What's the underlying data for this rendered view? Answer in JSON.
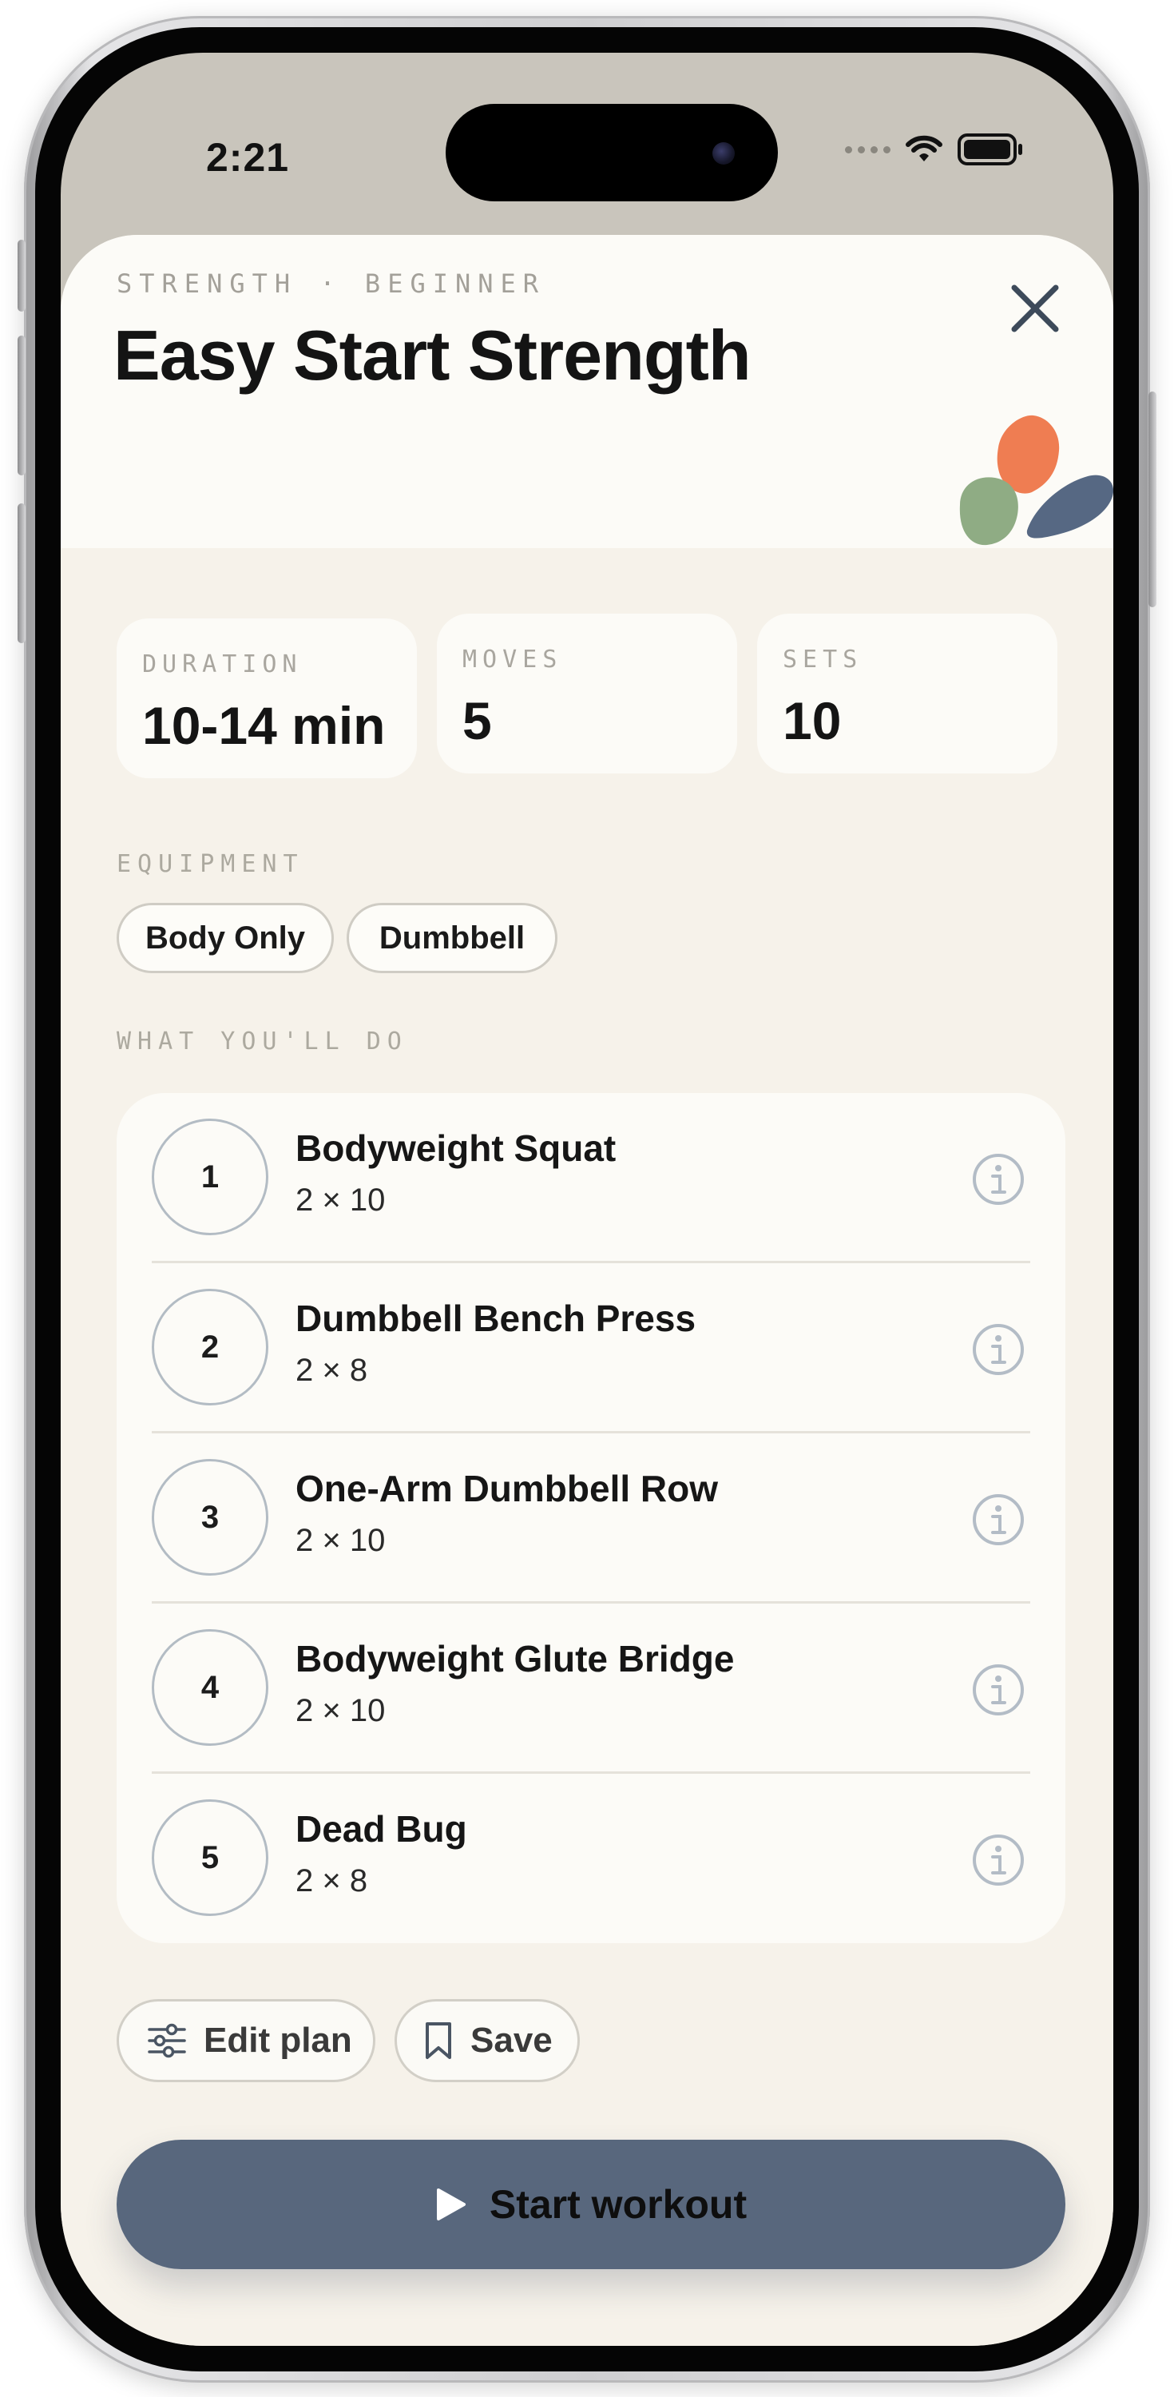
{
  "status_bar": {
    "time": "2:21"
  },
  "header": {
    "kicker": "STRENGTH · BEGINNER",
    "title": "Easy Start Strength"
  },
  "stats": [
    {
      "label": "DURATION",
      "value": "10-14 min"
    },
    {
      "label": "MOVES",
      "value": "5"
    },
    {
      "label": "SETS",
      "value": "10"
    }
  ],
  "equipment": {
    "label": "EQUIPMENT",
    "items": [
      "Body Only",
      "Dumbbell"
    ]
  },
  "plan": {
    "label": "WHAT YOU'LL DO",
    "exercises": [
      {
        "number": "1",
        "name": "Bodyweight Squat",
        "scheme": "2 × 10"
      },
      {
        "number": "2",
        "name": "Dumbbell Bench Press",
        "scheme": "2 × 8"
      },
      {
        "number": "3",
        "name": "One-Arm Dumbbell Row",
        "scheme": "2 × 10"
      },
      {
        "number": "4",
        "name": "Bodyweight Glute Bridge",
        "scheme": "2 × 10"
      },
      {
        "number": "5",
        "name": "Dead Bug",
        "scheme": "2 × 8"
      }
    ]
  },
  "actions": {
    "edit_label": "Edit plan",
    "save_label": "Save",
    "start_label": "Start workout"
  },
  "colors": {
    "accent": "#58677d",
    "sheet_background": "#f6f2ea",
    "card_background": "#fcfbf7",
    "blob_orange": "#ef7d52",
    "blob_green": "#8fac84",
    "blob_slate": "#566883"
  },
  "icons": {
    "close": "close-icon",
    "info": "info-icon",
    "edit": "sliders-icon",
    "save": "bookmark-icon",
    "start": "play-icon",
    "signal": "signal-dots-icon",
    "wifi": "wifi-icon",
    "battery": "battery-icon"
  }
}
